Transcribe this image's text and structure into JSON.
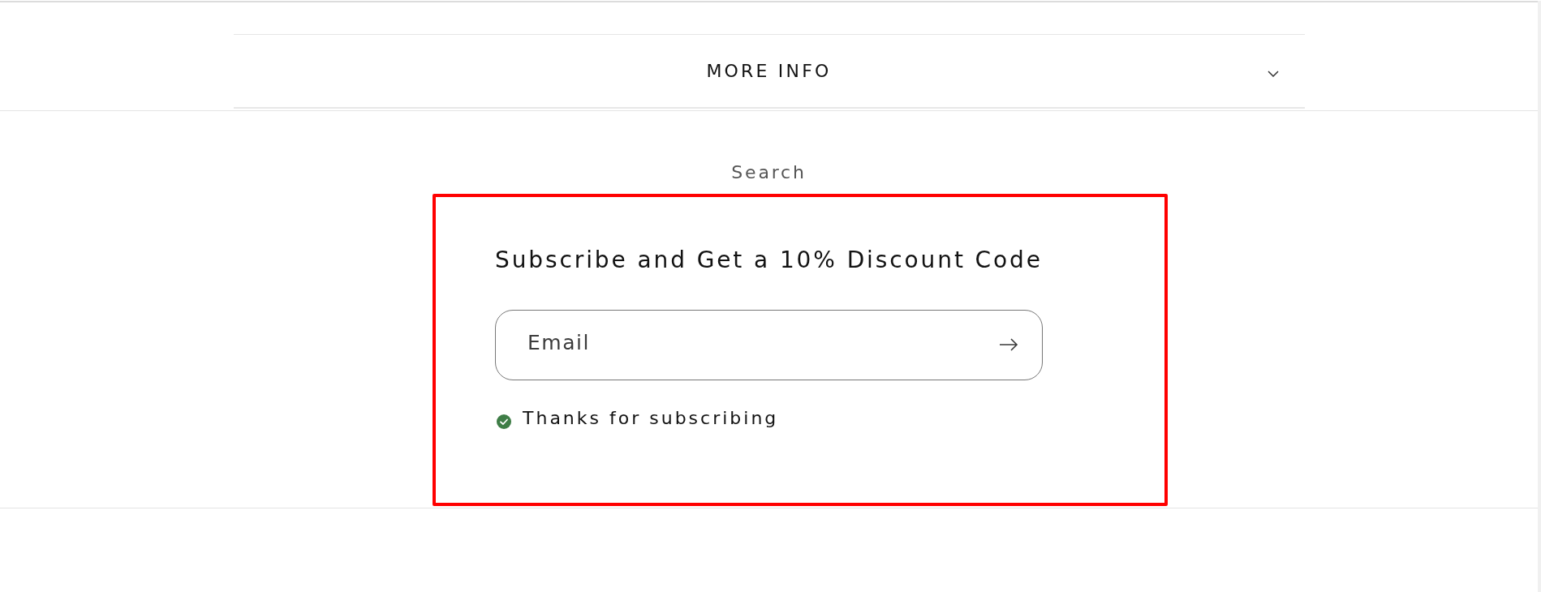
{
  "more_info": {
    "title": "MORE INFO",
    "expanded": false
  },
  "footer_links": [
    {
      "label": "Search"
    }
  ],
  "newsletter": {
    "highlighted": true,
    "heading": "Subscribe and Get a 10% Discount Code",
    "email_field": {
      "placeholder": "Email"
    },
    "message": {
      "kind": "success",
      "text": "Thanks for subscribing"
    }
  }
}
